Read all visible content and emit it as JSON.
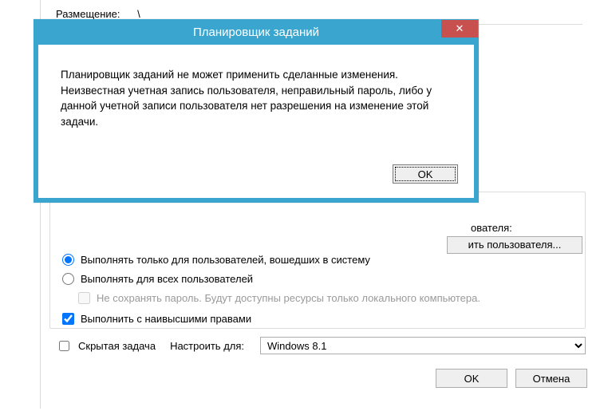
{
  "background": {
    "location_label": "Размещение:",
    "location_value": "\\",
    "user_label_fragment": "ователя:",
    "change_user_btn_visible_text": "ить пользователя...",
    "radio_logged_in": "Выполнять только для пользователей, вошедших в систему",
    "radio_all_users": "Выполнять для всех пользователей",
    "chk_no_save_pw": "Не сохранять пароль. Будут доступны ресурсы только локального компьютера.",
    "chk_highest_priv": "Выполнить с наивысшими правами",
    "chk_hidden_task": "Скрытая задача",
    "configure_for_label": "Настроить для:",
    "configure_for_value": "Windows 8.1",
    "ok": "OK",
    "cancel": "Отмена"
  },
  "modal": {
    "title": "Планировщик заданий",
    "message": "Планировщик заданий не может применить сделанные изменения. Неизвестная учетная запись пользователя, неправильный пароль, либо у данной учетной записи пользователя нет разрешения на изменение этой задачи.",
    "ok": "OK",
    "close_glyph": "✕"
  }
}
